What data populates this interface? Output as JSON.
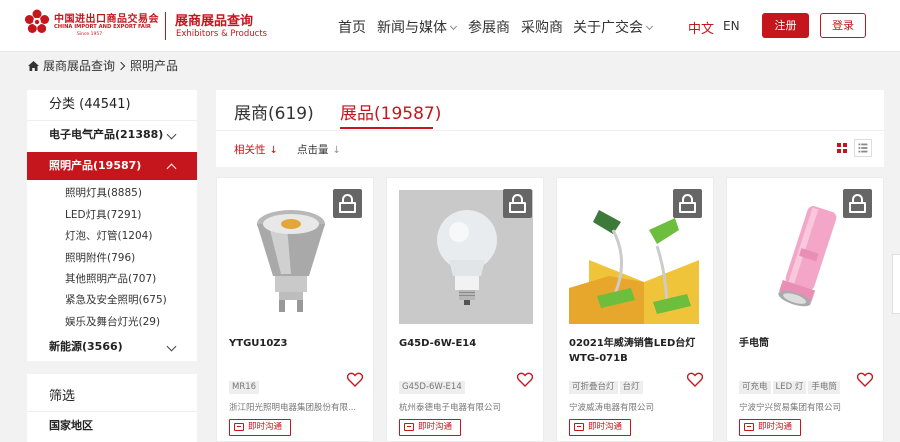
{
  "header": {
    "logo": {
      "cn": "中国进出口商品交易会",
      "en": "CHINA IMPORT AND EXPORT FAIR",
      "since": "Since 1957"
    },
    "section_title_cn": "展商展品查询",
    "section_title_en": "Exhibitors & Products",
    "nav": [
      {
        "label": "首页",
        "has_dropdown": false
      },
      {
        "label": "新闻与媒体",
        "has_dropdown": true
      },
      {
        "label": "参展商",
        "has_dropdown": false
      },
      {
        "label": "采购商",
        "has_dropdown": false
      },
      {
        "label": "关于广交会",
        "has_dropdown": true
      }
    ],
    "lang_cn": "中文",
    "lang_en": "EN",
    "register": "注册",
    "login": "登录"
  },
  "breadcrumb": {
    "items": [
      "展商展品查询",
      "照明产品"
    ]
  },
  "sidebar": {
    "heading": "分类 (44541)",
    "categories": [
      {
        "label": "电子电气产品(21388)",
        "expanded": false
      },
      {
        "label": "照明产品(19587)",
        "expanded": true
      },
      {
        "label": "新能源(3566)",
        "expanded": false
      }
    ],
    "subcategories": [
      "照明灯具(8885)",
      "LED灯具(7291)",
      "灯泡、灯管(1204)",
      "照明附件(796)",
      "其他照明产品(707)",
      "紧急及安全照明(675)",
      "娱乐及舞台灯光(29)"
    ],
    "filter_title": "筛选",
    "filter_region": "国家地区"
  },
  "tabs": {
    "exhibitors": "展商(619)",
    "products": "展品(19587)",
    "active": "products"
  },
  "sort": {
    "relevance": "相关性",
    "clicks": "点击量"
  },
  "products": [
    {
      "name": "YTGU10Z3",
      "tags": [
        "MR16"
      ],
      "company": "浙江阳光照明电器集团股份有限...",
      "chat_label": "即时沟通",
      "image": "gu10-led-spotlight"
    },
    {
      "name": "G45D-6W-E14",
      "tags": [
        "G45D-6W-E14"
      ],
      "company": "杭州泰德电子电器有限公司",
      "chat_label": "即时沟通",
      "image": "g45-led-bulb"
    },
    {
      "name": "02021年威涛销售LED台灯 WTG-071B",
      "tags": [
        "可折叠台灯",
        "台灯"
      ],
      "company": "宁波威涛电器有限公司",
      "chat_label": "即时沟通",
      "image": "green-desk-lamps"
    },
    {
      "name": "手电筒",
      "tags": [
        "可充电",
        "LED 灯",
        "手电筒"
      ],
      "company": "宁波宁兴贸易集团有限公司",
      "chat_label": "即时沟通",
      "image": "pink-flashlight"
    }
  ],
  "colors": {
    "brand_red": "#c4161c",
    "lock_overlay": "#666666"
  }
}
